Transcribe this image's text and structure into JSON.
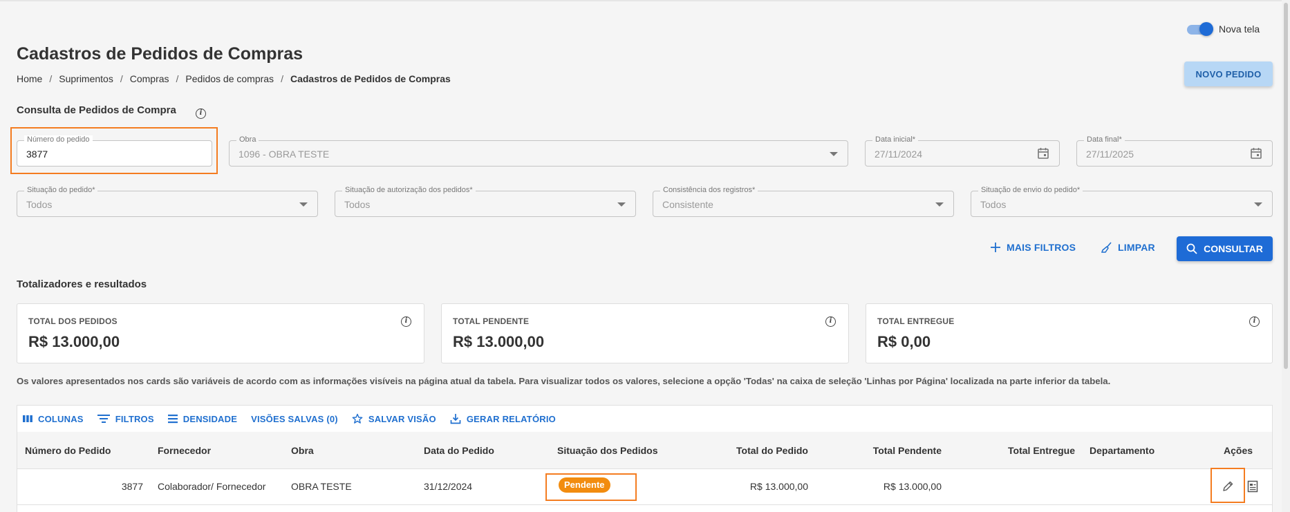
{
  "toggle": {
    "label": "Nova tela",
    "on": true
  },
  "page": {
    "title": "Cadastros de Pedidos de Compras"
  },
  "breadcrumb": {
    "items": [
      "Home",
      "Suprimentos",
      "Compras",
      "Pedidos de compras"
    ],
    "current": "Cadastros de Pedidos de Compras",
    "separator": "/"
  },
  "actions": {
    "novo_pedido": "NOVO PEDIDO"
  },
  "consulta": {
    "title": "Consulta de Pedidos de Compra",
    "info_icon": "i",
    "fields": {
      "numero": {
        "label": "Número do pedido",
        "value": "3877"
      },
      "obra": {
        "label": "Obra",
        "value": "1096 - OBRA TESTE"
      },
      "data_inicial": {
        "label": "Data inicial*",
        "value": "27/11/2024"
      },
      "data_final": {
        "label": "Data final*",
        "value": "27/11/2025"
      },
      "situacao": {
        "label": "Situação do pedido*",
        "value": "Todos"
      },
      "autorizacao": {
        "label": "Situação de autorização dos pedidos*",
        "value": "Todos"
      },
      "consistencia": {
        "label": "Consistência dos registros*",
        "value": "Consistente"
      },
      "envio": {
        "label": "Situação de envio do pedido*",
        "value": "Todos"
      }
    },
    "buttons": {
      "mais_filtros": "MAIS FILTROS",
      "limpar": "LIMPAR",
      "consultar": "CONSULTAR"
    }
  },
  "totalizadores": {
    "title": "Totalizadores e resultados",
    "cards": [
      {
        "label": "TOTAL DOS PEDIDOS",
        "value": "R$ 13.000,00"
      },
      {
        "label": "TOTAL PENDENTE",
        "value": "R$ 13.000,00"
      },
      {
        "label": "TOTAL ENTREGUE",
        "value": "R$ 0,00"
      }
    ],
    "note": "Os valores apresentados nos cards são variáveis de acordo com as informações visíveis na página atual da tabela. Para visualizar todos os valores, selecione a opção 'Todas' na caixa de seleção 'Linhas por Página' localizada na parte inferior da tabela."
  },
  "table": {
    "toolbar": {
      "colunas": "COLUNAS",
      "filtros": "FILTROS",
      "densidade": "DENSIDADE",
      "visoes": "VISÕES SALVAS (0)",
      "salvar": "SALVAR VISÃO",
      "relatorio": "GERAR RELATÓRIO"
    },
    "columns": [
      "Número do Pedido",
      "Fornecedor",
      "Obra",
      "Data do Pedido",
      "Situação dos Pedidos",
      "Total do Pedido",
      "Total Pendente",
      "Total Entregue",
      "Departamento",
      "Ações"
    ],
    "rows": [
      {
        "numero": "3877",
        "fornecedor": "Colaborador/ Fornecedor",
        "obra": "OBRA TESTE",
        "data": "31/12/2024",
        "situacao": "Pendente",
        "total": "R$ 13.000,00",
        "pendente": "R$ 13.000,00",
        "entregue": "",
        "departamento": ""
      }
    ]
  },
  "colors": {
    "primary": "#1e6bd6",
    "highlight": "#f47c20",
    "badge": "#f28c0f"
  }
}
